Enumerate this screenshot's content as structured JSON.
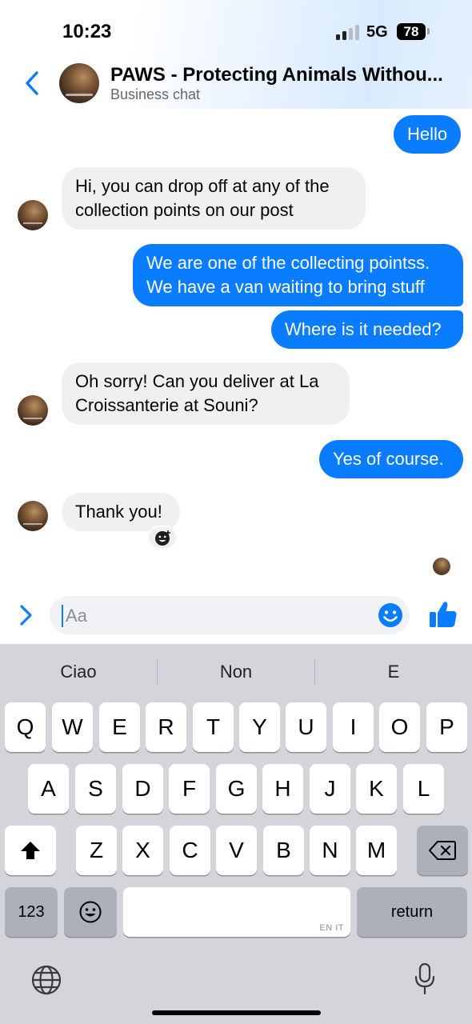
{
  "status_bar": {
    "time": "10:23",
    "network": "5G",
    "battery": "78"
  },
  "header": {
    "title": "PAWS - Protecting Animals Withou...",
    "subtitle": "Business chat",
    "colors": {
      "accent": "#0a7cff"
    }
  },
  "messages": [
    {
      "direction": "outgoing",
      "text": "Hello"
    },
    {
      "direction": "incoming",
      "lines": [
        "Hi, you can drop off at any of the",
        "collection points on our post"
      ]
    },
    {
      "direction": "outgoing",
      "lines": [
        "We are one of the collecting pointss.",
        "We have a van waiting to bring stuff"
      ]
    },
    {
      "direction": "outgoing",
      "text": "Where is it needed?"
    },
    {
      "direction": "incoming",
      "lines": [
        "Oh sorry! Can you deliver at La",
        "Croissanterie at Souni?"
      ]
    },
    {
      "direction": "outgoing",
      "text": "Yes of course."
    },
    {
      "direction": "incoming",
      "text": "Thank you!"
    }
  ],
  "composer": {
    "placeholder": "Aa"
  },
  "keyboard": {
    "suggestions": [
      "Ciao",
      "Non",
      "E"
    ],
    "row1": [
      "Q",
      "W",
      "E",
      "R",
      "T",
      "Y",
      "U",
      "I",
      "O",
      "P"
    ],
    "row2": [
      "A",
      "S",
      "D",
      "F",
      "G",
      "H",
      "J",
      "K",
      "L"
    ],
    "row3": [
      "Z",
      "X",
      "C",
      "V",
      "B",
      "N",
      "M"
    ],
    "numbers_label": "123",
    "return_label": "return",
    "space_lang": "EN IT"
  },
  "icons": [
    "chevron-left-icon",
    "chevron-right-icon",
    "emoji-icon",
    "thumbs-up-icon",
    "react-emoji-icon",
    "shift-icon",
    "backspace-icon",
    "globe-icon",
    "microphone-icon"
  ]
}
